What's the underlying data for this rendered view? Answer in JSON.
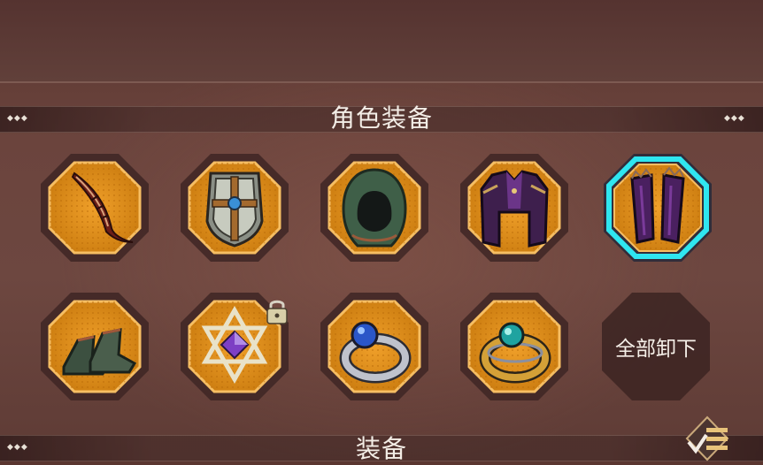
{
  "section": {
    "title": "角色装备"
  },
  "bottom_section": {
    "title": "装备"
  },
  "unequip_all": {
    "label": "全部卸下"
  },
  "equipment_slots": [
    {
      "slot": 1,
      "item": "curved-blade-icon",
      "selected": false
    },
    {
      "slot": 2,
      "item": "shield-icon",
      "selected": false
    },
    {
      "slot": 3,
      "item": "hood-icon",
      "selected": false
    },
    {
      "slot": 4,
      "item": "robe-armor-icon",
      "selected": false
    },
    {
      "slot": 5,
      "item": "bracers-icon",
      "selected": true
    },
    {
      "slot": 6,
      "item": "boots-icon",
      "selected": false
    },
    {
      "slot": 7,
      "item": "hexagram-amulet-icon",
      "selected": false,
      "locked": true
    },
    {
      "slot": 8,
      "item": "blue-gem-ring-icon",
      "selected": false
    },
    {
      "slot": 9,
      "item": "teal-gem-ring-icon",
      "selected": false
    }
  ],
  "colors": {
    "slot_fill": "#d98c14",
    "slot_border": "#f2b354",
    "selected_glow": "#2fe6f0",
    "background": "#6b443d"
  }
}
